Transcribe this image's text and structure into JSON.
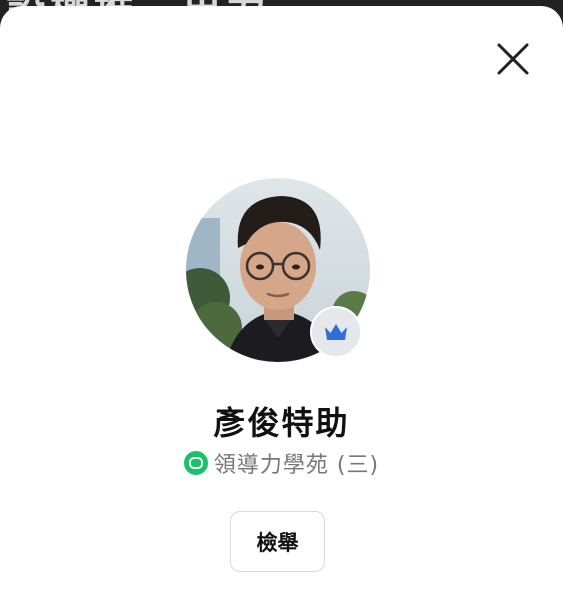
{
  "backdrop": {
    "partial_text": "設權推三出力"
  },
  "profile": {
    "name": "彥俊特助",
    "organization": "領導力學苑 (三)",
    "avatar_icon": "person-photo",
    "badge_icon": "crown-icon",
    "badge_color": "#2f6fd6",
    "org_icon": "open-chat-icon",
    "org_icon_color": "#18c26b"
  },
  "actions": {
    "close_icon": "close-icon",
    "report_label": "檢舉"
  }
}
